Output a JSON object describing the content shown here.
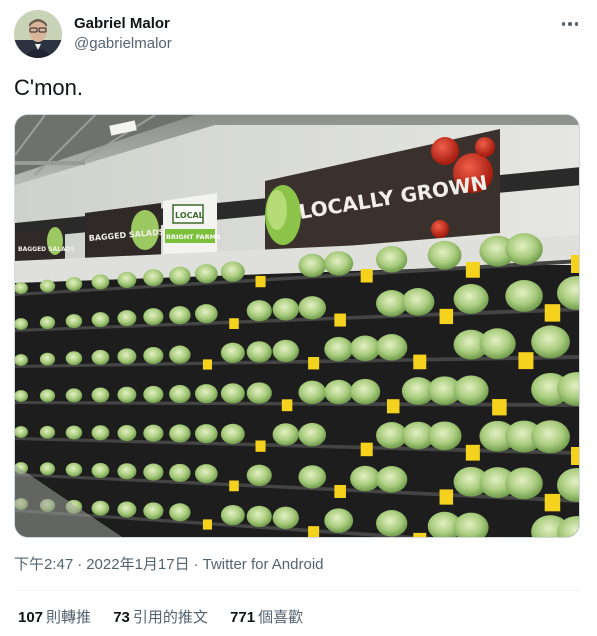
{
  "user": {
    "display_name": "Gabriel Malor",
    "handle": "@gabrielmalor"
  },
  "tweet": {
    "text": "C'mon."
  },
  "photo": {
    "signs": {
      "bagged_salads_left": "BAGGED SALADS",
      "bagged_salads": "BAGGED SALADS",
      "local_logo": "LOCAL",
      "farms_name": "BRIGHT FARMS",
      "locally_grown": "LOCALLY GROWN"
    }
  },
  "meta": {
    "time": "下午2:47",
    "separator": "·",
    "date": "2022年1月17日",
    "source": "Twitter for Android"
  },
  "stats": {
    "retweets_count": "107",
    "retweets_label": "則轉推",
    "quotes_count": "73",
    "quotes_label": "引用的推文",
    "likes_count": "771",
    "likes_label": "個喜歡"
  },
  "colors": {
    "text_primary": "#0f1419",
    "text_secondary": "#536471",
    "divider": "#eff3f4",
    "sign_dark": "#3a302c",
    "sign_green": "#7bbf3a",
    "price_tag": "#f5d21d"
  }
}
